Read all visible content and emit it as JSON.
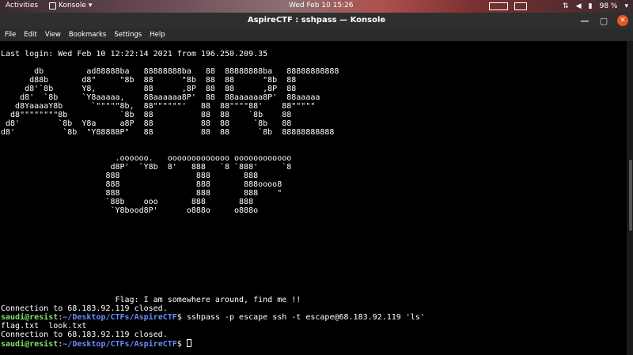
{
  "topbar": {
    "activities": "Activities",
    "app_name": "Konsole",
    "app_caret": "▾",
    "clock": "Wed Feb 10  15:26",
    "battery": "98 %",
    "tray_caret": "▾"
  },
  "window": {
    "title": "AspireCTF : sshpass — Konsole",
    "minimize": "—",
    "maximize": "▢",
    "close": "✕"
  },
  "menu": [
    "File",
    "Edit",
    "View",
    "Bookmarks",
    "Settings",
    "Help"
  ],
  "terminal": {
    "last_login": "Last login: Wed Feb 10 12:22:14 2021 from 196.250.209.35",
    "banner": [
      "       db         ad88888ba   88888888ba   88  88888888ba   88888888888",
      "      d88b       d8\"     \"8b  88      \"8b  88  88      \"8b  88",
      "     d8'`8b      Y8,          88      ,8P  88  88      ,8P  88",
      "    d8'  `8b     `Y8aaaaa,    88aaaaaa8P'  88  88aaaaaa8P'  88aaaaa",
      "   d8YaaaaY8b      `\"\"\"\"\"8b,  88\"\"\"\"\"\"'   88  88\"\"\"\"88'    88\"\"\"\"\"",
      "  d8\"\"\"\"\"\"\"\"8b           `8b  88          88  88    `8b    88",
      " d8'        `8b  Y8a     a8P  88          88  88     `8b   88",
      "d8'          `8b  \"Y88888P\"   88          88  88      `8b  88888888888"
    ],
    "banner2": [
      "                        .oooooo.   ooooooooooooo oooooooooooo",
      "                       d8P'  `Y8b  8'   888   `8 `888'     `8",
      "                      888                888       888",
      "                      888                888       888oooo8",
      "                      888                888       888    \"",
      "                      `88b    ooo       888       888",
      "                       `Y8bood8P'      o888o     o888o"
    ],
    "flag_line": "                        Flag: I am somewhere around, find me !!",
    "closed1": "Connection to 68.183.92.119 closed.",
    "prompt_user": "saudi@resist",
    "prompt_sep": ":",
    "prompt_path": "~/Desktop/CTFs/AspireCTF",
    "prompt_end": "$ ",
    "command": "sshpass -p escape ssh -t escape@68.183.92.119 'ls'",
    "ls_output": "flag.txt  look.txt",
    "closed2": "Connection to 68.183.92.119 closed."
  }
}
